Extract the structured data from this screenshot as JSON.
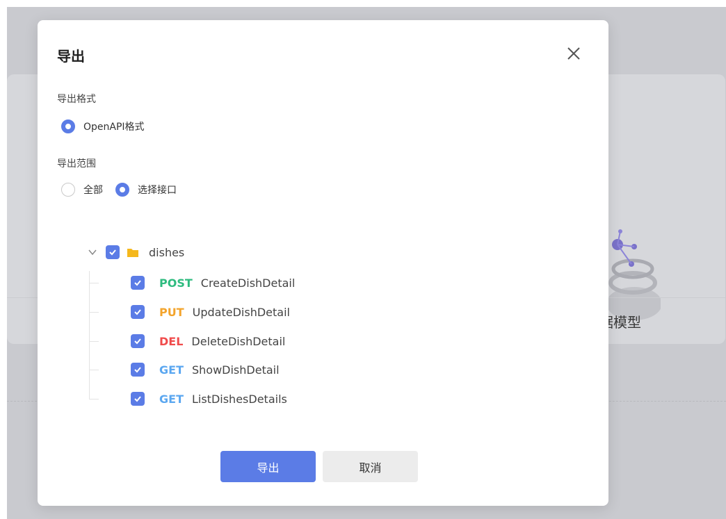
{
  "background": {
    "card_label": "据模型"
  },
  "modal": {
    "title": "导出",
    "format_section": {
      "label": "导出格式",
      "options": [
        {
          "label": "OpenAPI格式",
          "checked": true
        }
      ]
    },
    "scope_section": {
      "label": "导出范围",
      "options": [
        {
          "label": "全部",
          "checked": false
        },
        {
          "label": "选择接口",
          "checked": true
        }
      ]
    },
    "tree": {
      "folder": {
        "name": "dishes",
        "checked": true,
        "expanded": true
      },
      "items": [
        {
          "method": "POST",
          "name": "CreateDishDetail",
          "checked": true
        },
        {
          "method": "PUT",
          "name": "UpdateDishDetail",
          "checked": true
        },
        {
          "method": "DEL",
          "name": "DeleteDishDetail",
          "checked": true
        },
        {
          "method": "GET",
          "name": "ShowDishDetail",
          "checked": true
        },
        {
          "method": "GET",
          "name": "ListDishesDetails",
          "checked": true
        }
      ]
    },
    "buttons": {
      "confirm": "导出",
      "cancel": "取消"
    }
  },
  "colors": {
    "primary": "#5b7ce6",
    "post": "#2ebb7f",
    "put": "#f3a42c",
    "del": "#f04b4b",
    "get": "#5ba7f0"
  }
}
